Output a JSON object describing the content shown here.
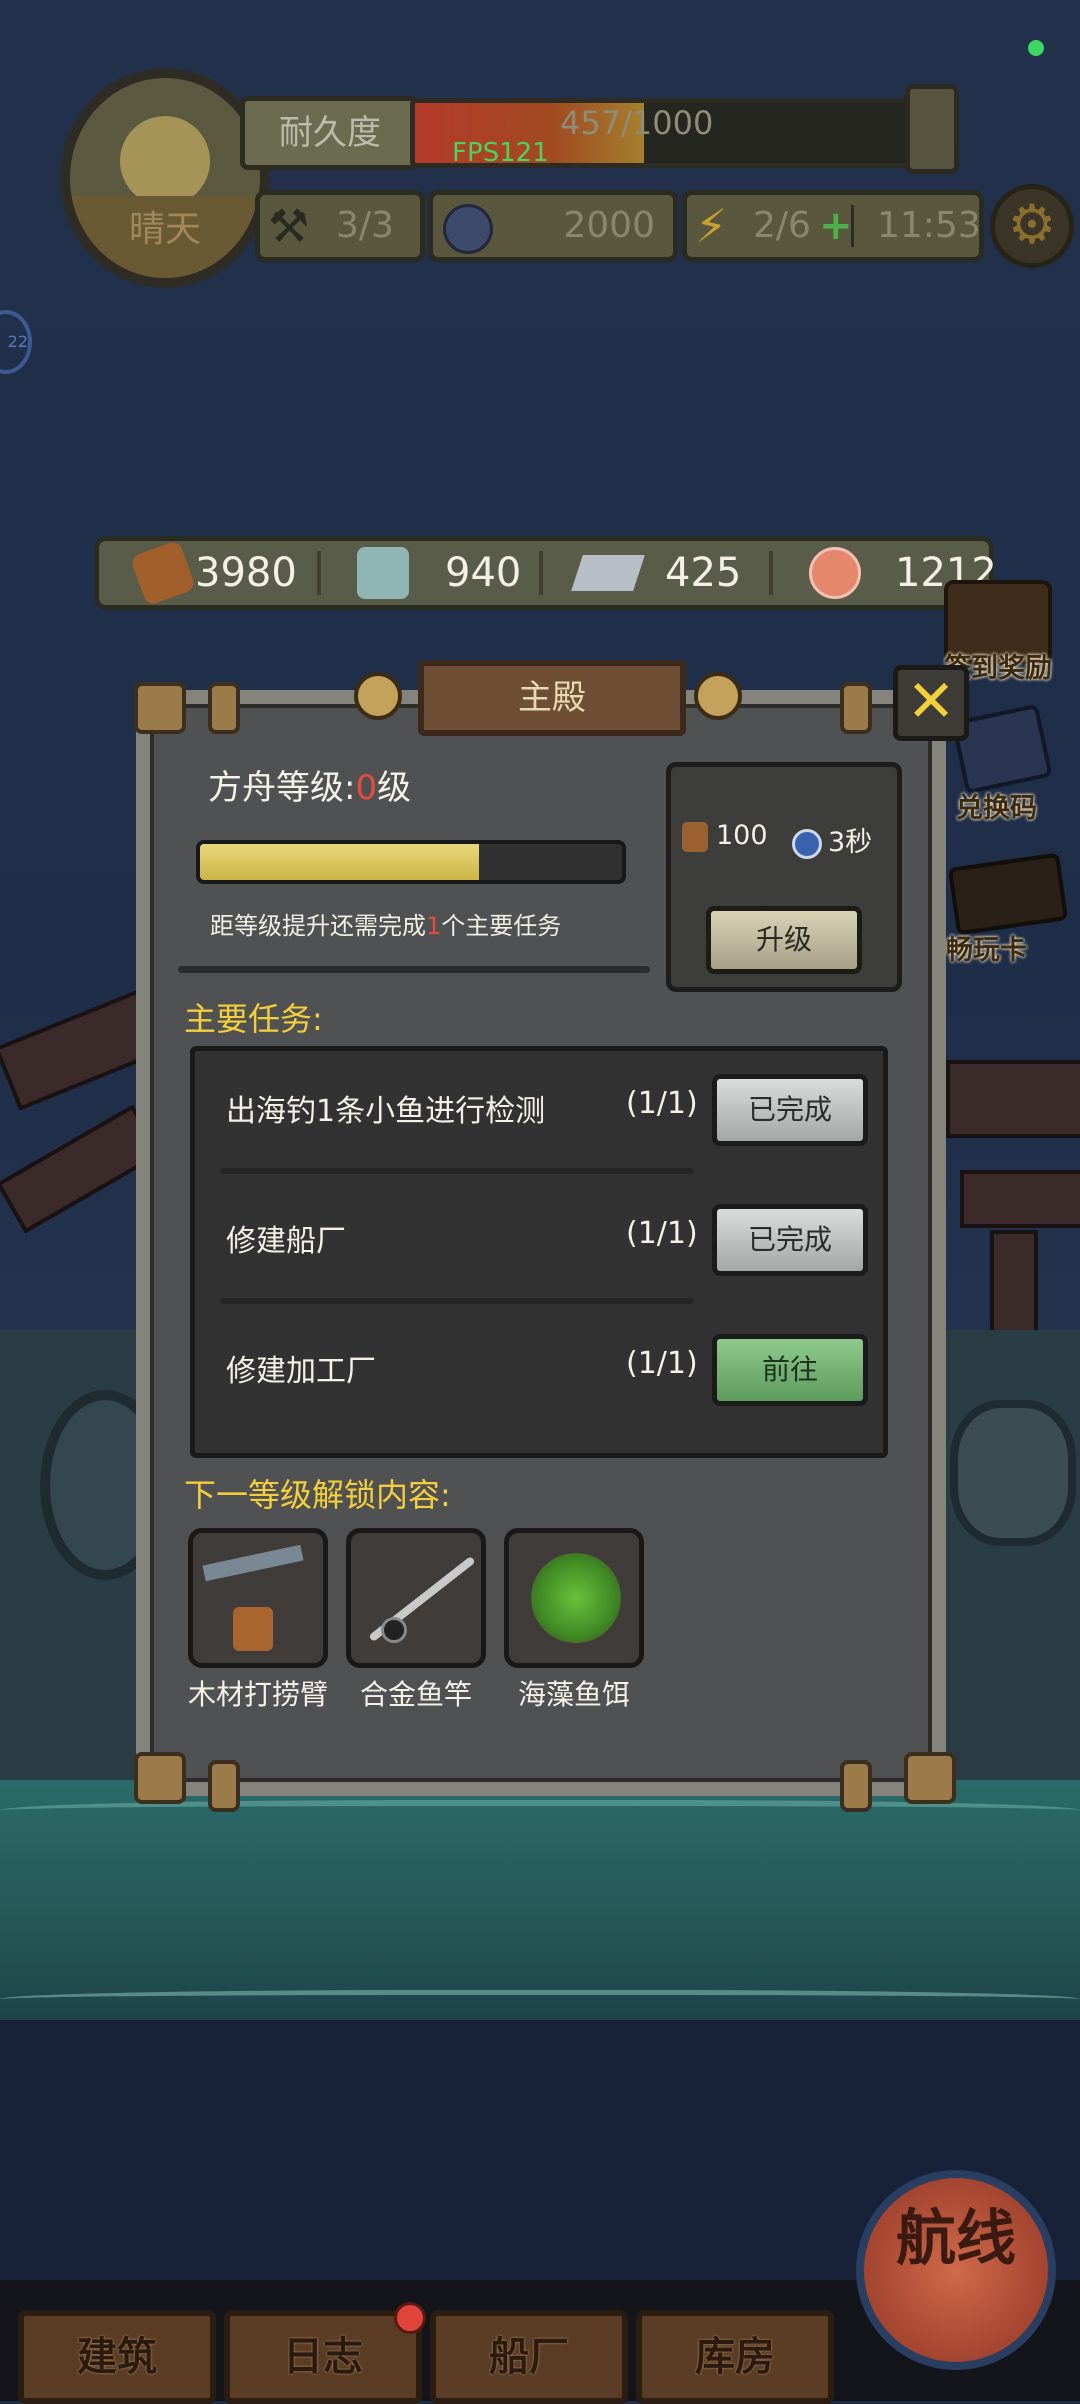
{
  "hud": {
    "weather": "晴天",
    "durability_label": "耐久度",
    "durability_text": "457/1000",
    "durability_fraction": 0.457,
    "fps": "FPS121",
    "hammer_count": "3/3",
    "gear_count": "2000",
    "energy_count": "2/6",
    "energy_plus": "+",
    "energy_timer": "11:53",
    "settings_icon": "gear-icon",
    "side_bubble": "22"
  },
  "resources": [
    {
      "icon": "wood-log-icon",
      "value": "3980"
    },
    {
      "icon": "lumber-icon",
      "value": "940"
    },
    {
      "icon": "iron-ingot-icon",
      "value": "425"
    },
    {
      "icon": "fish-meat-icon",
      "value": "1212"
    }
  ],
  "side_menu": [
    {
      "icon": "treasure-chest-icon",
      "label": "签到奖励"
    },
    {
      "icon": "ticket-icon",
      "label": "兑换码"
    },
    {
      "icon": "card-icon",
      "label": "畅玩卡"
    }
  ],
  "dialog": {
    "title": "主殿",
    "close_icon": "close-icon",
    "level_prefix": "方舟等级:",
    "level_value": "0",
    "level_suffix": "级",
    "level_progress": 0.66,
    "hint_prefix": "距等级提升还需完成",
    "hint_num": "1",
    "hint_suffix": "个主要任务",
    "cost_wood": "100",
    "cost_time": "3秒",
    "upgrade_label": "升级",
    "tasks_heading": "主要任务:",
    "tasks": [
      {
        "name": "出海钓1条小鱼进行检测",
        "progress": "(1/1)",
        "button": "已完成",
        "state": "done"
      },
      {
        "name": "修建船厂",
        "progress": "(1/1)",
        "button": "已完成",
        "state": "done"
      },
      {
        "name": "修建加工厂",
        "progress": "(1/1)",
        "button": "前往",
        "state": "go"
      }
    ],
    "unlock_heading": "下一等级解锁内容:",
    "unlock_items": [
      {
        "icon": "salvage-arm-icon",
        "label": "木材打捞臂"
      },
      {
        "icon": "fishing-rod-icon",
        "label": "合金鱼竿"
      },
      {
        "icon": "seaweed-bait-icon",
        "label": "海藻鱼饵"
      }
    ]
  },
  "nav": {
    "items": [
      "建筑",
      "日志",
      "船厂",
      "库房"
    ],
    "sail": "航线"
  },
  "colors": {
    "accent_yellow": "#f5ce3c",
    "level_red": "#e64a40",
    "go_green": "#7cbf7a"
  }
}
